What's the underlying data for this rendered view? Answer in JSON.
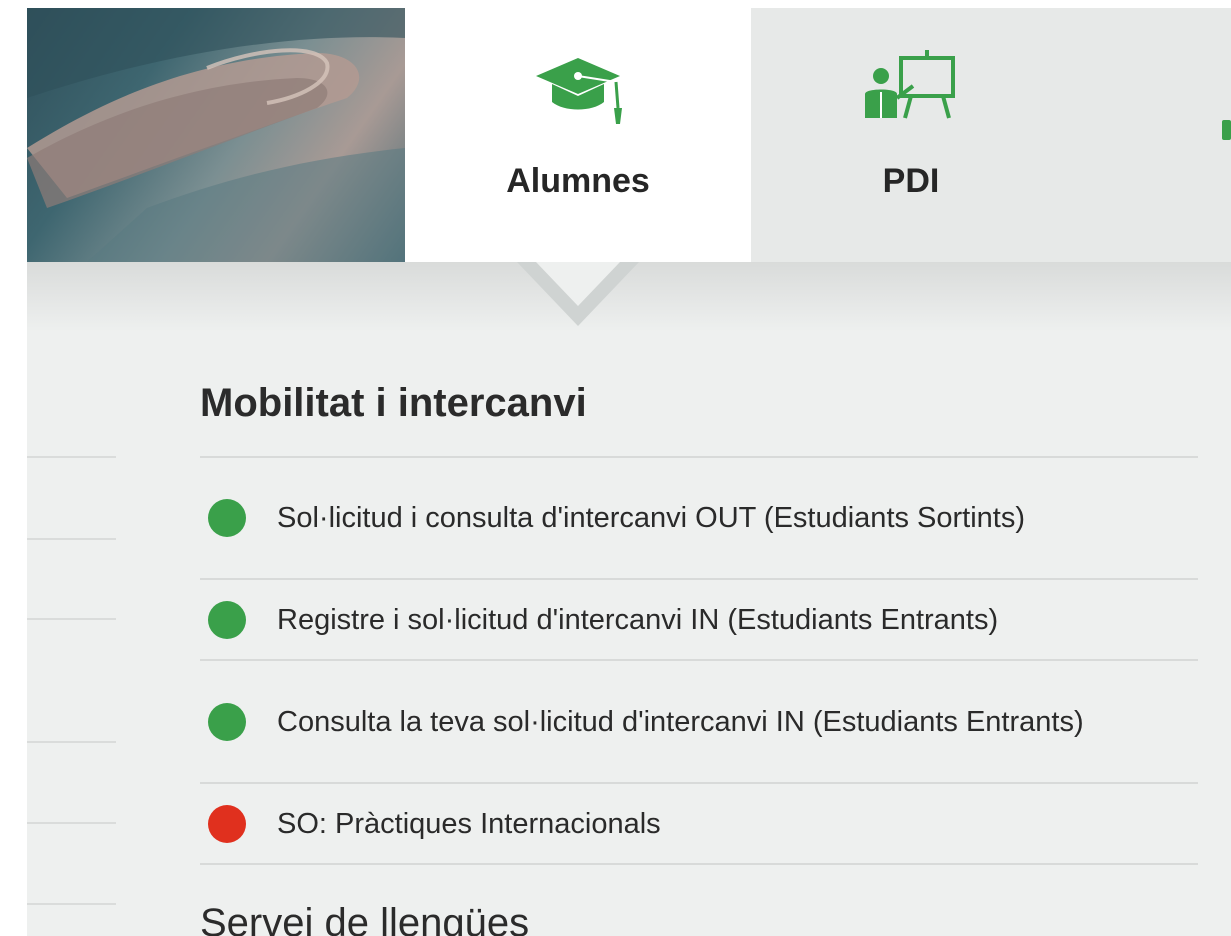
{
  "tabs": [
    {
      "label": "Alumnes",
      "icon": "graduation-cap-icon",
      "active": true
    },
    {
      "label": "PDI",
      "icon": "teacher-whiteboard-icon",
      "active": false
    }
  ],
  "colors": {
    "accent": "#3aa04a",
    "status_green": "#3aa04a",
    "status_red": "#e0301e"
  },
  "section": {
    "title": "Mobilitat i intercanvi",
    "items": [
      {
        "label": "Sol·licitud i consulta d'intercanvi OUT (Estudiants Sortints)",
        "status": "green"
      },
      {
        "label": "Registre i sol·licitud d'intercanvi IN (Estudiants Entrants)",
        "status": "green"
      },
      {
        "label": "Consulta la teva sol·licitud d'intercanvi IN (Estudiants Entrants)",
        "status": "green"
      },
      {
        "label": "SO: Pràctiques Internacionals",
        "status": "red"
      }
    ]
  },
  "next_section": {
    "title": "Servei de llengües"
  }
}
